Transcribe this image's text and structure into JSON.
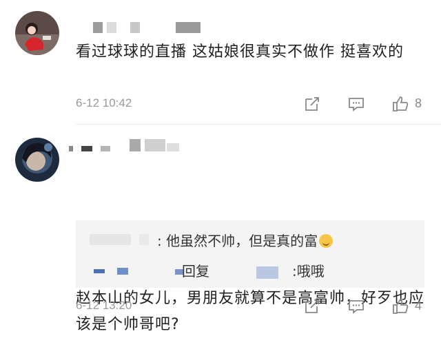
{
  "comments": [
    {
      "text": "看过球球的直播 这姑娘很真实不做作 挺喜欢的",
      "time": "6-12 10:42",
      "likes": "8",
      "icons": {
        "share": "share-icon",
        "reply": "comment-icon",
        "like": "thumbs-up-icon"
      }
    },
    {
      "text": "赵本山的女儿，男朋友就算不是高富帅，好歹也应该是个帅哥吧?",
      "time": "6-12 13:20",
      "likes": "4",
      "replies": [
        {
          "text": ": 他虽然不帅，但是真的富",
          "emoji": "laughing-emoji"
        },
        {
          "prefix": "回复",
          "text": ":哦哦"
        }
      ]
    }
  ]
}
